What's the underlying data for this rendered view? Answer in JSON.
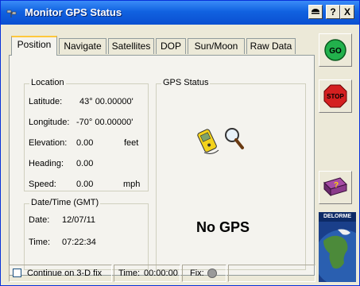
{
  "window": {
    "title": "Monitor GPS Status"
  },
  "title_buttons": {
    "help": "?",
    "close": "X"
  },
  "tabs": [
    {
      "label": "Position"
    },
    {
      "label": "Navigate"
    },
    {
      "label": "Satellites"
    },
    {
      "label": "DOP"
    },
    {
      "label": "Sun/Moon"
    },
    {
      "label": "Raw Data"
    }
  ],
  "location": {
    "title": "Location",
    "latitude_label": "Latitude:",
    "latitude_value": "43° 00.00000'",
    "longitude_label": "Longitude:",
    "longitude_value": "-70° 00.00000'",
    "elevation_label": "Elevation:",
    "elevation_value": "0.00",
    "elevation_unit": "feet",
    "heading_label": "Heading:",
    "heading_value": "0.00",
    "speed_label": "Speed:",
    "speed_value": "0.00",
    "speed_unit": "mph"
  },
  "datetime": {
    "title": "Date/Time (GMT)",
    "date_label": "Date:",
    "date_value": "12/07/11",
    "time_label": "Time:",
    "time_value": "07:22:34"
  },
  "gps_status": {
    "title": "GPS Status",
    "message": "No GPS"
  },
  "side_buttons": {
    "go": "GO",
    "stop": "STOP",
    "help_book": "?"
  },
  "brand": {
    "name": "DELORME"
  },
  "statusbar": {
    "continue_label": "Continue on 3-D fix",
    "time_label": "Time:",
    "time_value": "00:00:00",
    "fix_label": "Fix:"
  },
  "colors": {
    "titlebar": "#0a4fd1",
    "tab_active_accent": "#ffc83c",
    "go": "#22b14c",
    "stop": "#d42020"
  }
}
